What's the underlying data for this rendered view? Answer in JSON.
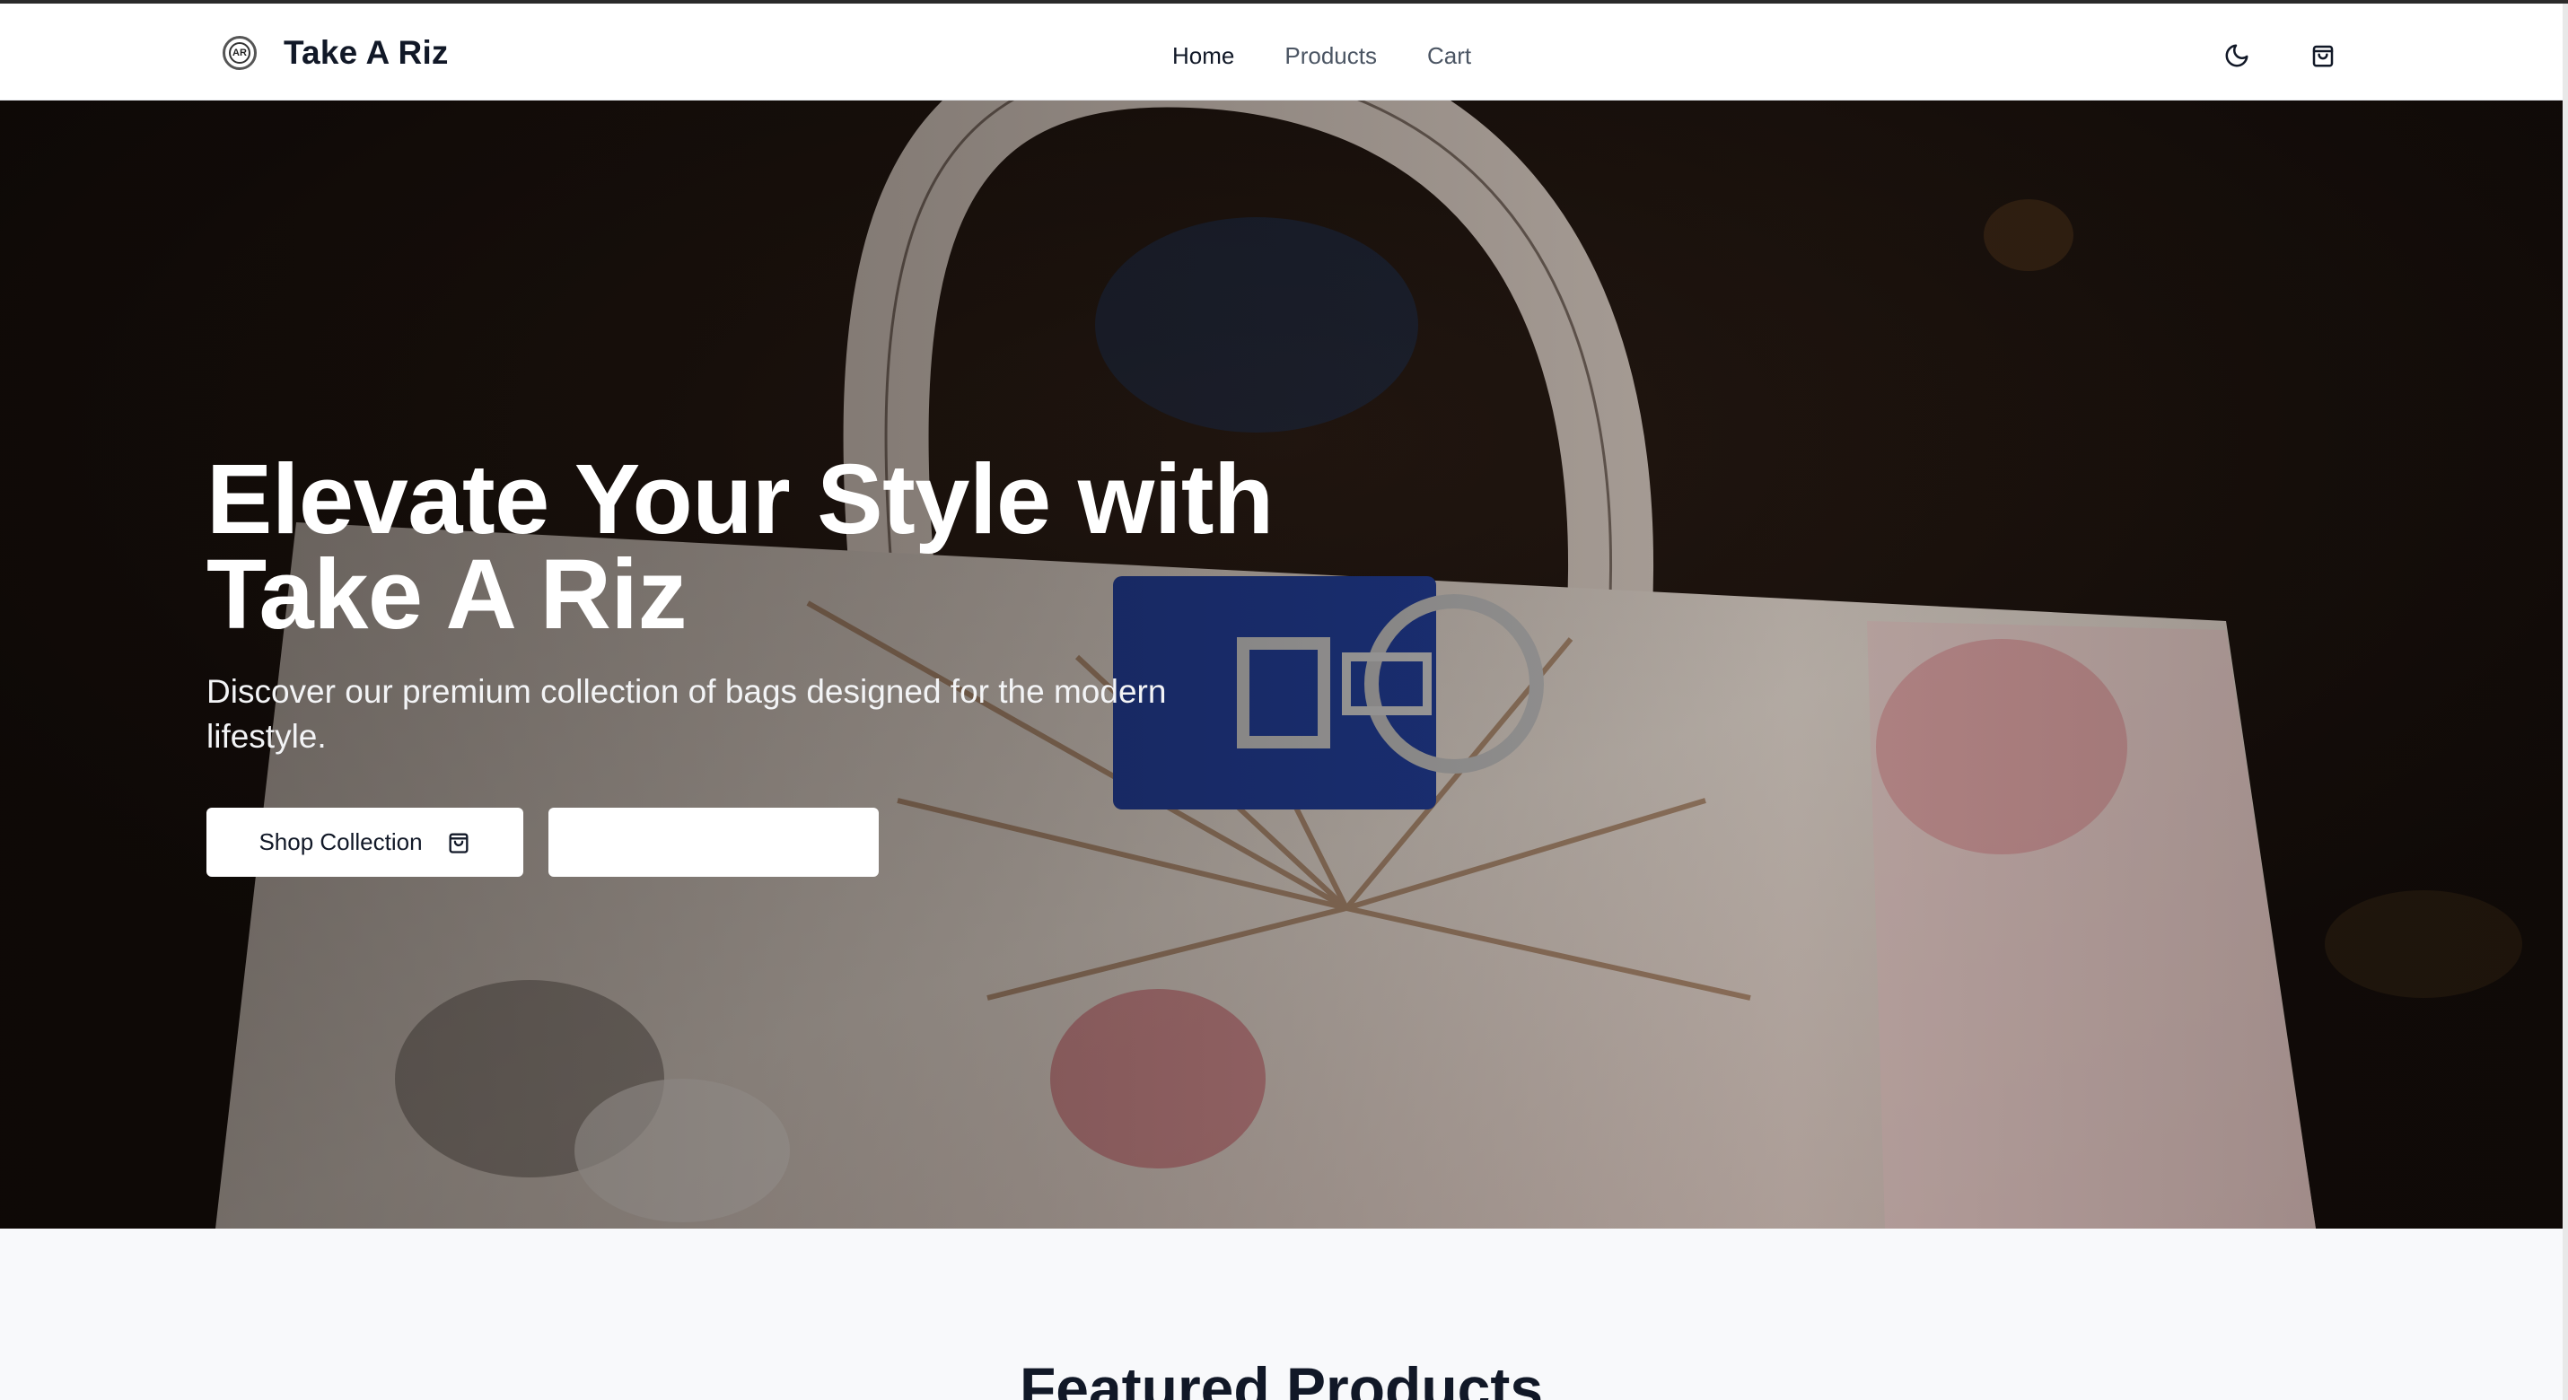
{
  "header": {
    "brand_name": "Take A Riz",
    "logo_text": "AR",
    "nav": [
      "Home",
      "Products",
      "Cart"
    ],
    "active_nav": "Home",
    "theme_toggle_icon": "moon-icon",
    "cart_icon": "shopping-bag-icon"
  },
  "hero": {
    "title": "Elevate Your Style with Take A Riz",
    "subtitle": "Discover our premium collection of bags designed for the modern lifestyle.",
    "primary_button": "Shop Collection",
    "primary_button_icon": "shopping-bag-icon",
    "secondary_button": "",
    "background_image": "floral-handbag-photo"
  },
  "featured": {
    "title": "Featured Products"
  },
  "colors": {
    "text_primary": "#111827",
    "nav_inactive": "#4b5563",
    "hero_text": "#ffffff",
    "button_bg": "#ffffff",
    "page_bg": "#f8f9fb"
  }
}
